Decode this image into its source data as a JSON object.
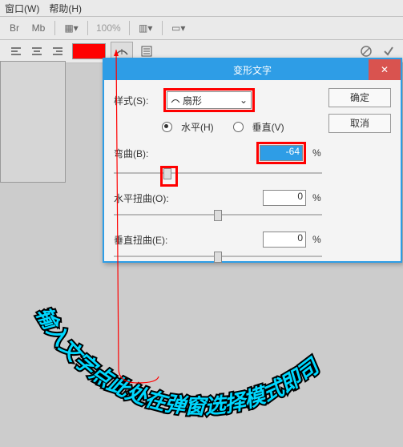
{
  "menu": {
    "window": "窗口(W)",
    "help": "帮助(H)"
  },
  "toolbar1": {
    "br": "Br",
    "mb": "Mb",
    "zoom": "100%"
  },
  "dialog": {
    "title": "变形文字",
    "style_label": "样式(S):",
    "style_value": "扇形",
    "horiz": "水平(H)",
    "vert": "垂直(V)",
    "bend_label": "弯曲(B):",
    "bend_value": "-64",
    "hdist_label": "水平扭曲(O):",
    "hdist_value": "0",
    "vdist_label": "垂直扭曲(E):",
    "vdist_value": "0",
    "pct": "%",
    "ok": "确定",
    "cancel": "取消"
  },
  "curved_text": "输入文字点此处在弹窗选择模式即司"
}
